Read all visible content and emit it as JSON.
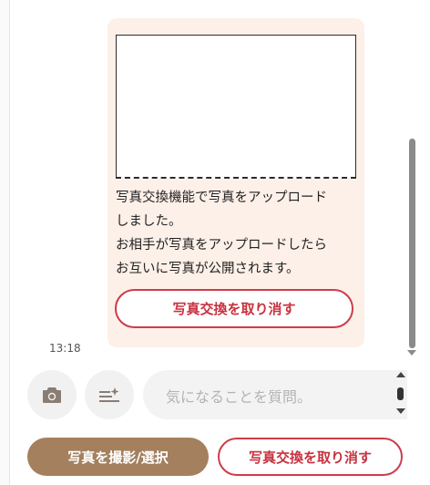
{
  "chat": {
    "message_lines": [
      "写真交換機能で写真をアップロード",
      "しました。",
      "お相手が写真をアップロードしたら",
      "お互いに写真が公開されます。"
    ],
    "cancel_label": "写真交換を取り消す",
    "time": "13:18"
  },
  "composer": {
    "camera_icon": "camera-icon",
    "template_icon": "template-sparkle-icon",
    "placeholder": "気になることを質問。"
  },
  "actions": {
    "take_select_label": "写真を撮影/選択",
    "cancel_exchange_label": "写真交換を取り消す"
  },
  "colors": {
    "bubble_bg": "#fdf0e8",
    "accent_red": "#cc3d4b",
    "primary_brown": "#a4805e",
    "icon_gray": "#8a7d74"
  }
}
